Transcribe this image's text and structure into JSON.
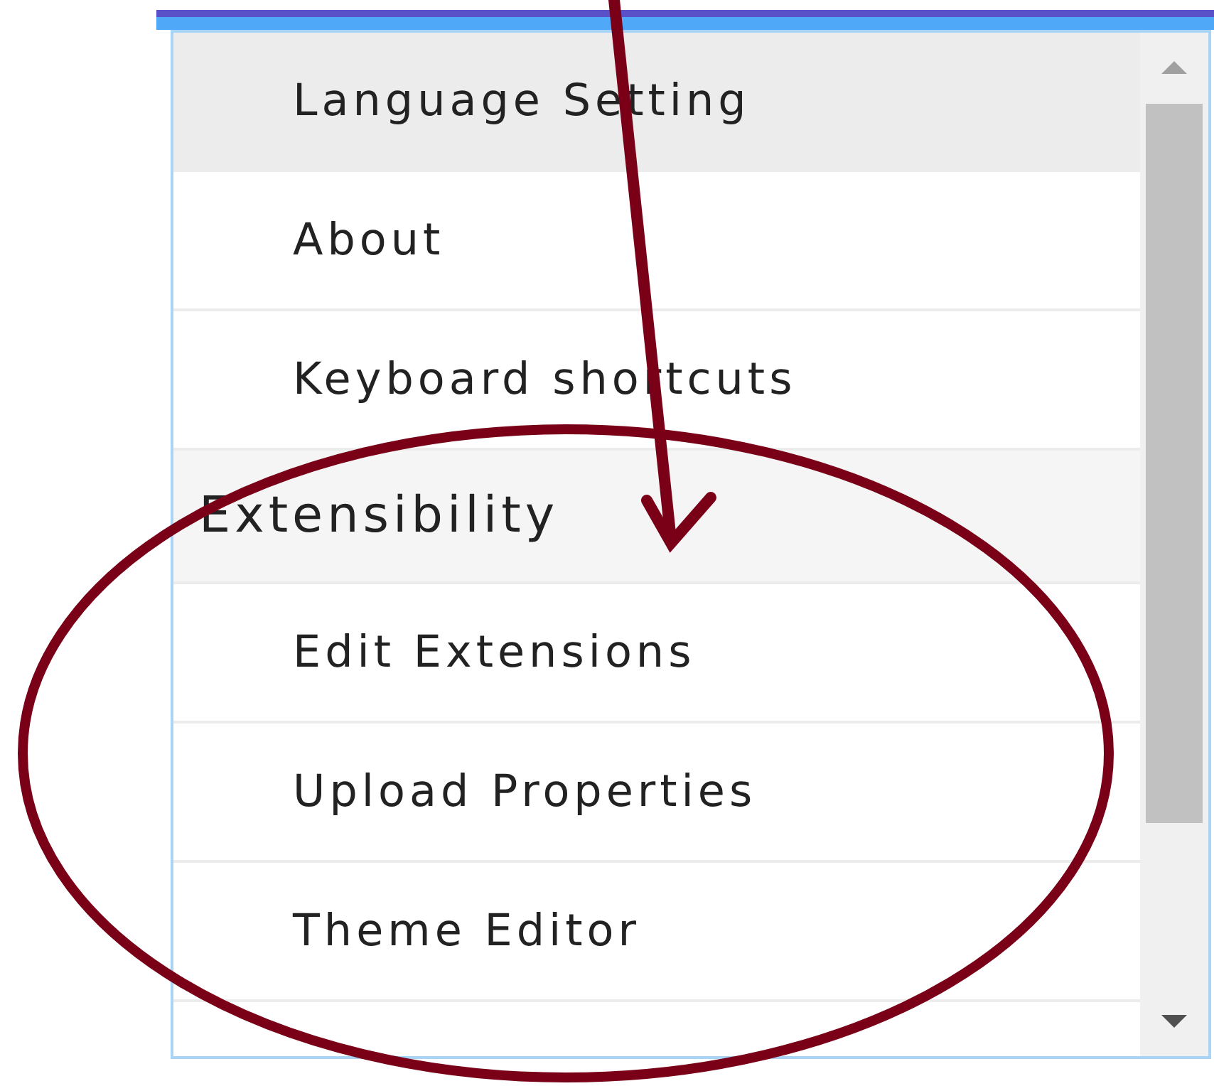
{
  "menu": {
    "items": [
      {
        "kind": "item",
        "label": "Language Setting",
        "selected": true
      },
      {
        "kind": "item",
        "label": "About",
        "selected": false
      },
      {
        "kind": "item",
        "label": "Keyboard shortcuts",
        "selected": false
      },
      {
        "kind": "header",
        "label": "Extensibility"
      },
      {
        "kind": "item",
        "label": "Edit Extensions",
        "selected": false
      },
      {
        "kind": "item",
        "label": "Upload Properties",
        "selected": false
      },
      {
        "kind": "item",
        "label": "Theme Editor",
        "selected": false
      }
    ]
  }
}
